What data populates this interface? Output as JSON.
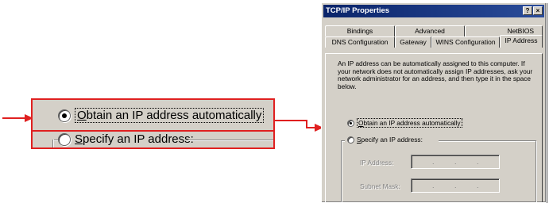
{
  "zoom": {
    "radio1_label_pre": "",
    "radio1_label_ul": "O",
    "radio1_label_post": "btain an IP address automatically",
    "radio2_label_ul": "S",
    "radio2_label_post": "pecify an IP address:"
  },
  "dialog": {
    "title": "TCP/IP Properties",
    "help_button": "?",
    "close_button": "×",
    "tabs_row1": [
      "Bindings",
      "Advanced",
      "NetBIOS"
    ],
    "tabs_row2": [
      "DNS Configuration",
      "Gateway",
      "WINS Configuration",
      "IP Address"
    ],
    "active_tab": "IP Address",
    "description": "An IP address can be automatically assigned to this computer. If your network does not automatically assign IP addresses, ask your network administrator for an address, and then type it in the space below.",
    "radio1_ul": "O",
    "radio1_post": "btain an IP address automatically",
    "radio2_ul": "S",
    "radio2_post": "pecify an IP address:",
    "ip_label": "IP Address:",
    "mask_label": "Subnet Mask:",
    "dot": "."
  },
  "colors": {
    "callout": "#e02020",
    "titlebar": "#0a246a",
    "face": "#d4d0c8"
  }
}
